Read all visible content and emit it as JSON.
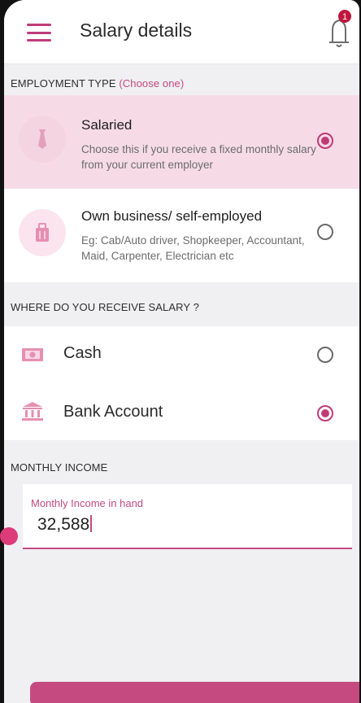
{
  "header": {
    "title": "Salary details",
    "notification_count": "1"
  },
  "employment": {
    "section_label": "EMPLOYMENT TYPE",
    "section_hint": "(Choose one)",
    "options": [
      {
        "title": "Salaried",
        "description": "Choose this if you receive a fixed monthly salary from your current employer",
        "selected": true,
        "icon": "tie-icon"
      },
      {
        "title": "Own business/ self-employed",
        "description": "Eg: Cab/Auto driver, Shopkeeper, Accountant, Maid, Carpenter, Electrician etc",
        "selected": false,
        "icon": "briefcase-icon"
      }
    ]
  },
  "receive": {
    "section_label": "WHERE DO YOU RECEIVE SALARY ?",
    "options": [
      {
        "label": "Cash",
        "selected": false,
        "icon": "cash-icon"
      },
      {
        "label": "Bank Account",
        "selected": true,
        "icon": "bank-icon"
      }
    ]
  },
  "income": {
    "section_label": "MONTHLY INCOME",
    "field_label": "Monthly Income in hand",
    "value": "32,588"
  },
  "colors": {
    "accent": "#bf3b78",
    "selected_card": "#f6dbe6"
  }
}
